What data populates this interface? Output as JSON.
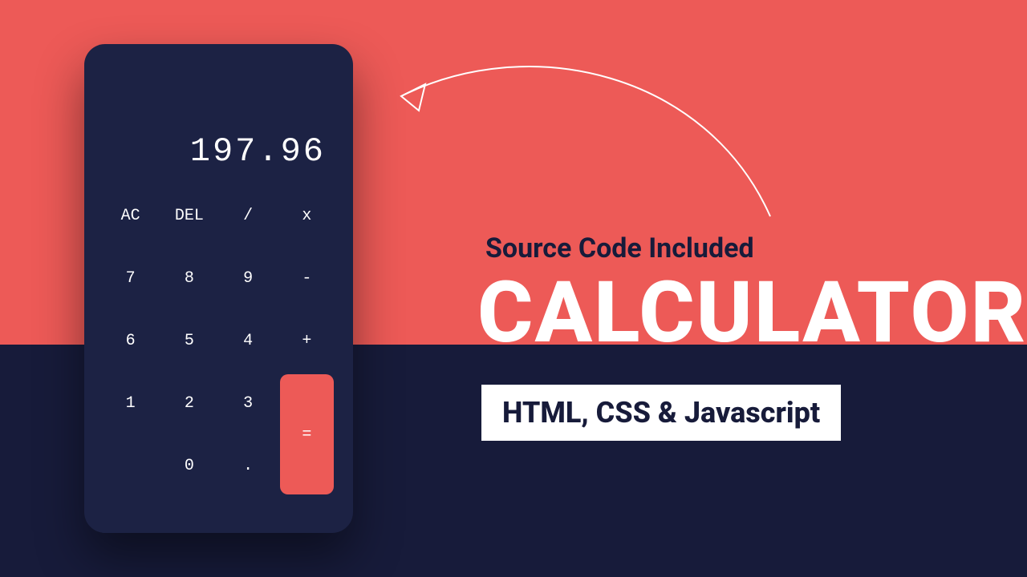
{
  "display": "197.96",
  "keys": {
    "ac": "AC",
    "del": "DEL",
    "div": "/",
    "mul": "x",
    "k7": "7",
    "k8": "8",
    "k9": "9",
    "sub": "-",
    "k6": "6",
    "k5": "5",
    "k4": "4",
    "add": "+",
    "k1": "1",
    "k2": "2",
    "k3": "3",
    "eq": "=",
    "k0": "0",
    "dot": "."
  },
  "text": {
    "subhead": "Source Code Included",
    "title": "CALCULATOR",
    "pill": "HTML, CSS & Javascript"
  },
  "colors": {
    "coral": "#ed5a57",
    "navy": "#171b3a",
    "panel": "#1c2244",
    "white": "#ffffff"
  }
}
